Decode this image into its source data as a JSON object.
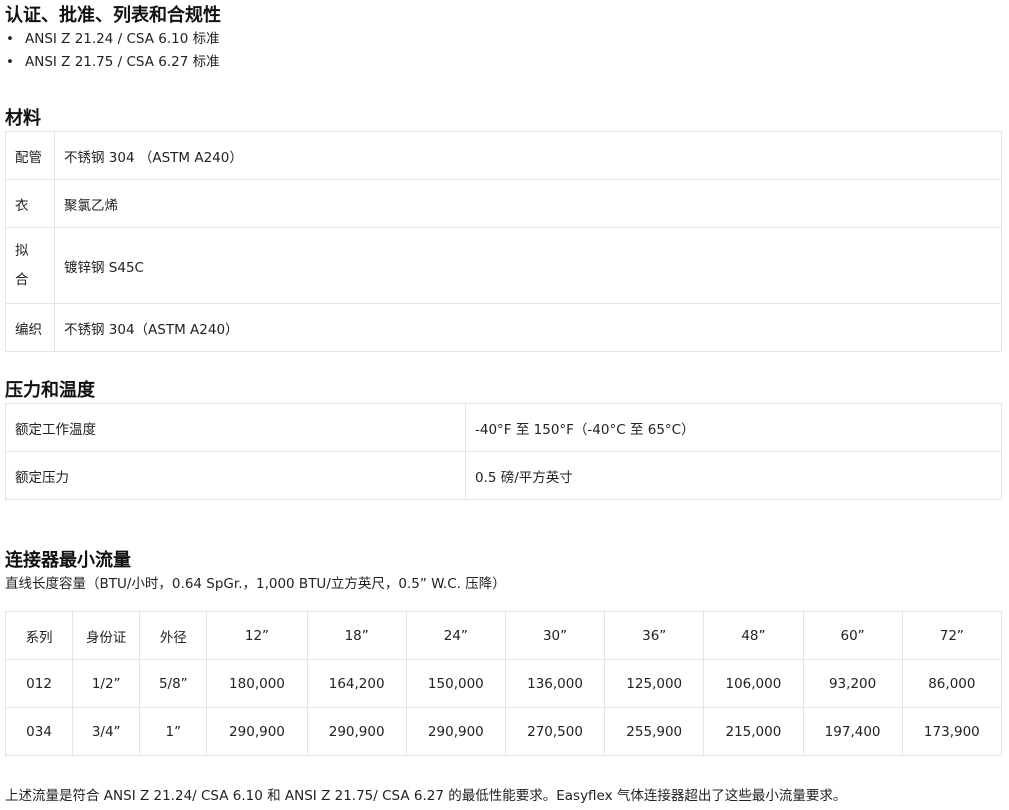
{
  "certifications": {
    "title": "认证、批准、列表和合规性",
    "items": [
      "ANSI Z 21.24 / CSA 6.10 标准",
      "ANSI Z 21.75 / CSA 6.27 标准"
    ]
  },
  "materials": {
    "title": "材料",
    "rows": [
      {
        "label": "配管",
        "value": "不锈钢 304 （ASTM A240）"
      },
      {
        "label": "衣",
        "value": "聚氯乙烯"
      },
      {
        "label_line1": "拟",
        "label_line2": "合",
        "value": "镀锌钢 S45C"
      },
      {
        "label": "编织",
        "value": "不锈钢 304（ASTM A240）"
      }
    ]
  },
  "pressure": {
    "title": "压力和温度",
    "rows": [
      {
        "label": "额定工作温度",
        "value": "-40°F 至 150°F（-40°C 至 65°C）"
      },
      {
        "label": "额定压力",
        "value": "0.5 磅/平方英寸"
      }
    ]
  },
  "flow": {
    "title": "连接器最小流量",
    "subtitle": "直线长度容量（BTU/小时，0.64 SpGr.，1,000 BTU/立方英尺，0.5” W.C. 压降）",
    "headers": [
      "系列",
      "身份证",
      "外径",
      "12”",
      "18”",
      "24”",
      "30”",
      "36”",
      "48”",
      "60”",
      "72”"
    ],
    "rows": [
      [
        "012",
        "1/2”",
        "5/8”",
        "180,000",
        "164,200",
        "150,000",
        "136,000",
        "125,000",
        "106,000",
        "93,200",
        "86,000"
      ],
      [
        "034",
        "3/4”",
        "1”",
        "290,900",
        "290,900",
        "290,900",
        "270,500",
        "255,900",
        "215,000",
        "197,400",
        "173,900"
      ]
    ]
  },
  "footnote": "上述流量是符合 ANSI Z 21.24/ CSA 6.10 和 ANSI Z 21.75/ CSA 6.27 的最低性能要求。Easyflex 气体连接器超出了这些最小流量要求。"
}
